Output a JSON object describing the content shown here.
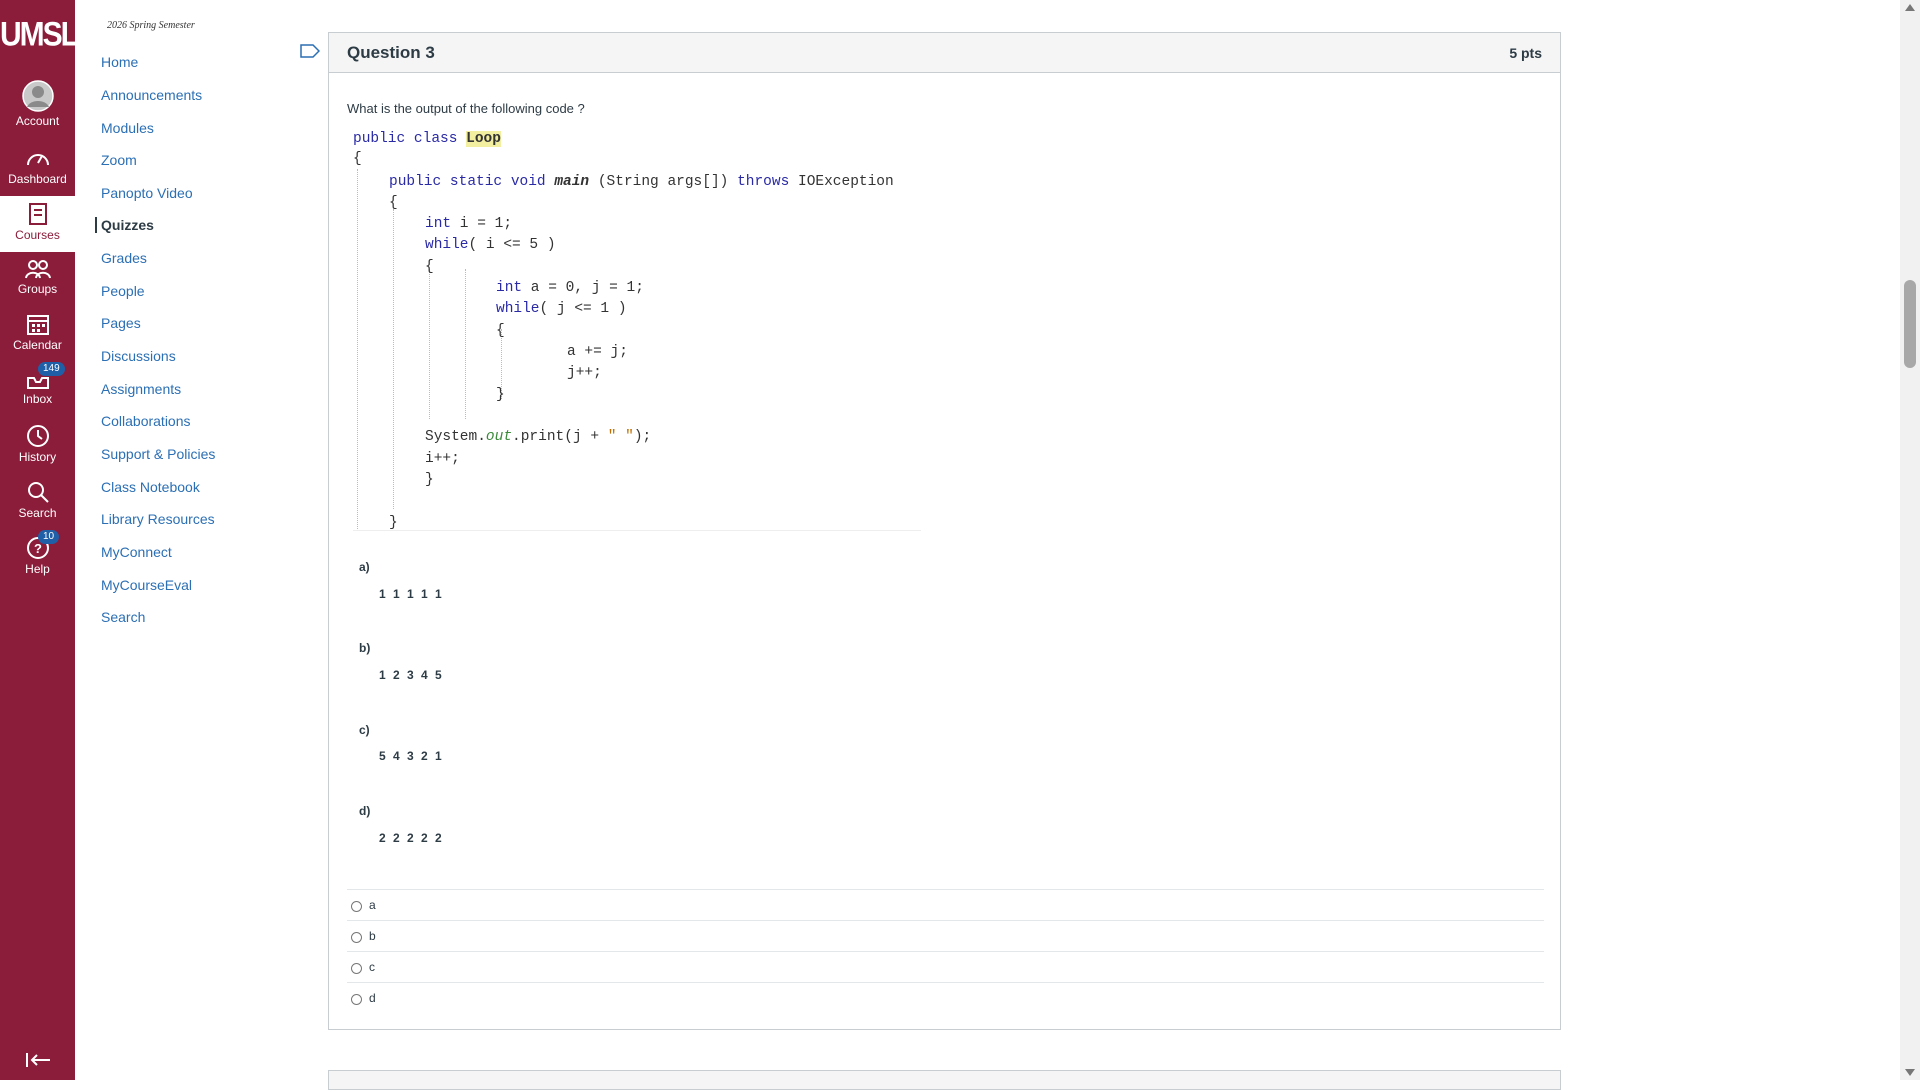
{
  "global_nav": {
    "logo": "UMSL",
    "items": [
      {
        "label": "Account",
        "icon": "account-avatar-icon"
      },
      {
        "label": "Dashboard",
        "icon": "dashboard-icon"
      },
      {
        "label": "Courses",
        "icon": "courses-icon",
        "active": true
      },
      {
        "label": "Groups",
        "icon": "groups-icon"
      },
      {
        "label": "Calendar",
        "icon": "calendar-icon"
      },
      {
        "label": "Inbox",
        "icon": "inbox-icon",
        "badge": "149"
      },
      {
        "label": "History",
        "icon": "history-icon"
      },
      {
        "label": "Search",
        "icon": "search-icon"
      },
      {
        "label": "Help",
        "icon": "help-icon",
        "badge": "10"
      }
    ],
    "colors": {
      "background": "#8b1c3a",
      "badge": "#1f5fa8"
    }
  },
  "course_nav": {
    "term": "2026 Spring Semester",
    "items": [
      "Home",
      "Announcements",
      "Modules",
      "Zoom",
      "Panopto Video",
      "Quizzes",
      "Grades",
      "People",
      "Pages",
      "Discussions",
      "Assignments",
      "Collaborations",
      "Support & Policies",
      "Class Notebook",
      "Library Resources",
      "MyConnect",
      "MyCourseEval",
      "Search"
    ],
    "active": "Quizzes",
    "link_color": "#2b6fb4"
  },
  "question": {
    "title": "Question 3",
    "points": "5 pts",
    "prompt": "What is the output of the following code ?",
    "code": {
      "l1_kw": "public class ",
      "l1_name": "Loop",
      "l2": "{",
      "l3_kw": "public static void ",
      "l3_main": "main",
      "l3_args": " (String args[]) ",
      "l3_throws": "throws",
      "l3_exc": " IOException",
      "l4": "{",
      "l5_kw": "int",
      "l5_rest": " i = 1;",
      "l6_kw": "while",
      "l6_rest": "( i <= 5 )",
      "l7": "{",
      "l8_kw": "int",
      "l8_rest": " a = 0, j = 1;",
      "l9_kw": "while",
      "l9_rest": "( j <= 1 )",
      "l10": "{",
      "l11": "a += j;",
      "l12": "j++;",
      "l13": "}",
      "l14_a": "System.",
      "l14_out": "out",
      "l14_b": ".print(j + ",
      "l14_str": "\" \"",
      "l14_c": ");",
      "l15": "i++;",
      "l16": "}",
      "l17": "}"
    },
    "answers": [
      {
        "letter": "a)",
        "value": "1 1 1 1 1"
      },
      {
        "letter": "b)",
        "value": "1 2 3 4 5"
      },
      {
        "letter": "c)",
        "value": "5 4 3 2 1"
      },
      {
        "letter": "d)",
        "value": "2 2 2 2 2"
      }
    ],
    "choices": [
      "a",
      "b",
      "c",
      "d"
    ]
  }
}
